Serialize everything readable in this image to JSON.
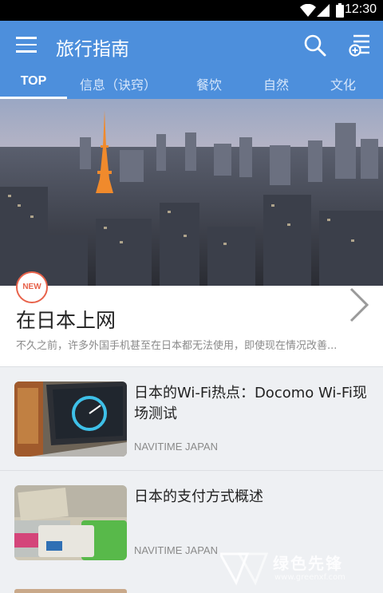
{
  "status_bar": {
    "time": "12:30"
  },
  "app_bar": {
    "title": "旅行指南"
  },
  "tabs": [
    {
      "label": "TOP",
      "active": true
    },
    {
      "label": "信息（诀窍）",
      "active": false
    },
    {
      "label": "餐饮",
      "active": false
    },
    {
      "label": "自然",
      "active": false
    },
    {
      "label": "文化",
      "active": false
    }
  ],
  "featured": {
    "badge": "NEW",
    "title": "在日本上网",
    "description": "不久之前，许多外国手机甚至在日本都无法使用，即使现在情况改善..."
  },
  "articles": [
    {
      "title": "日本的Wi-Fi热点：Docomo Wi-Fi现场测试",
      "source": "NAVITIME JAPAN"
    },
    {
      "title": "日本的支付方式概述",
      "source": "NAVITIME JAPAN"
    }
  ],
  "watermark": {
    "text": "绿色先锋",
    "url": "www.greenxf.com"
  },
  "colors": {
    "accent": "#4d8fdc",
    "badge": "#e8624a"
  }
}
